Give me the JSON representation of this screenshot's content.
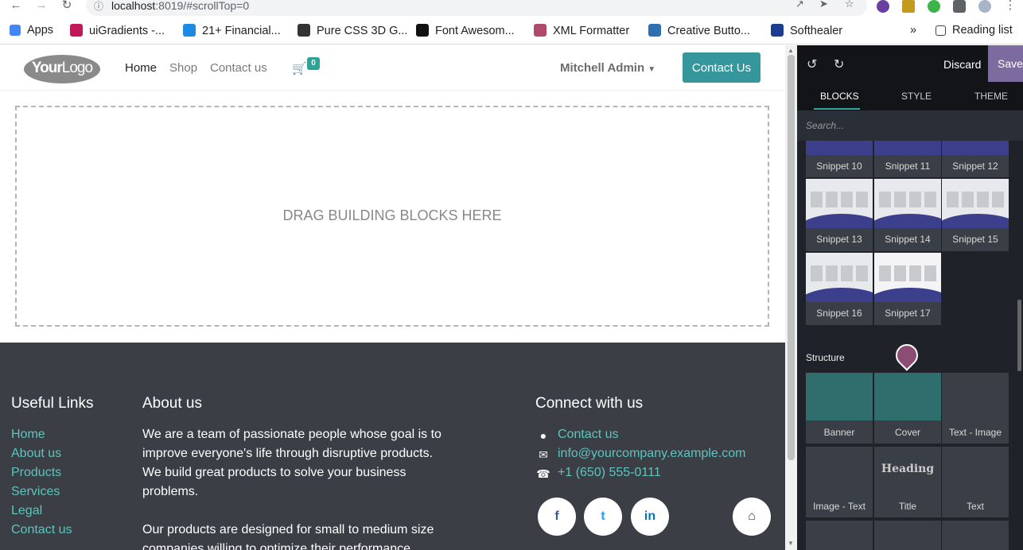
{
  "browser": {
    "url_host": "localhost",
    "url_rest": ":8019/#scrollTop=0",
    "bookmarks": [
      {
        "label": "Apps",
        "color": "#4285f4"
      },
      {
        "label": "uiGradients -...",
        "color": "#c2185b"
      },
      {
        "label": "21+ Financial...",
        "color": "#1e88e5"
      },
      {
        "label": "Pure CSS 3D G...",
        "color": "#333333"
      },
      {
        "label": "Font Awesom...",
        "color": "#111111"
      },
      {
        "label": "XML Formatter",
        "color": "#b04a6a"
      },
      {
        "label": "Creative Butto...",
        "color": "#2f6fb0"
      },
      {
        "label": "Softhealer",
        "color": "#1a3d8f"
      }
    ],
    "more": "»",
    "reading_list": "Reading list"
  },
  "site": {
    "logo_bold": "Your",
    "logo_rest": "Logo",
    "menu": [
      {
        "label": "Home",
        "active": true
      },
      {
        "label": "Shop",
        "active": false
      },
      {
        "label": "Contact us",
        "active": false
      }
    ],
    "cart_count": "0",
    "user": "Mitchell Admin",
    "contact_btn": "Contact Us",
    "dropzone": "DRAG BUILDING BLOCKS HERE"
  },
  "footer": {
    "useful_title": "Useful Links",
    "links": [
      "Home",
      "About us",
      "Products",
      "Services",
      "Legal",
      "Contact us"
    ],
    "about_title": "About us",
    "about_p1": [
      "We are a team of passionate people whose goal is to",
      "improve everyone's life through disruptive products.",
      "We build great products to solve your business",
      "problems."
    ],
    "about_p2": [
      "Our products are designed for small to medium size",
      "companies willing to optimize their performance."
    ],
    "connect_title": "Connect with us",
    "contact_link": "Contact us",
    "email": "info@yourcompany.example.com",
    "phone": "+1 (650) 555-0111",
    "social": [
      "f",
      "t",
      "in",
      "home"
    ]
  },
  "editor": {
    "discard": "Discard",
    "save": "Save",
    "tabs": [
      "BLOCKS",
      "STYLE",
      "THEME"
    ],
    "search_placeholder": "Search...",
    "snippets": [
      "Snippet 10",
      "Snippet 11",
      "Snippet 12",
      "Snippet 13",
      "Snippet 14",
      "Snippet 15",
      "Snippet 16",
      "Snippet 17"
    ],
    "structure_title": "Structure",
    "structure": [
      "Banner",
      "Cover",
      "Text - Image",
      "Image - Text",
      "Title",
      "Text"
    ],
    "title_thumb": "Heading"
  },
  "colors": {
    "accent": "#35979c",
    "link": "#5ec4bd",
    "footer_bg": "#3b3e45",
    "panel_bg": "#1f2329",
    "save_bg": "#7c6b9e"
  }
}
